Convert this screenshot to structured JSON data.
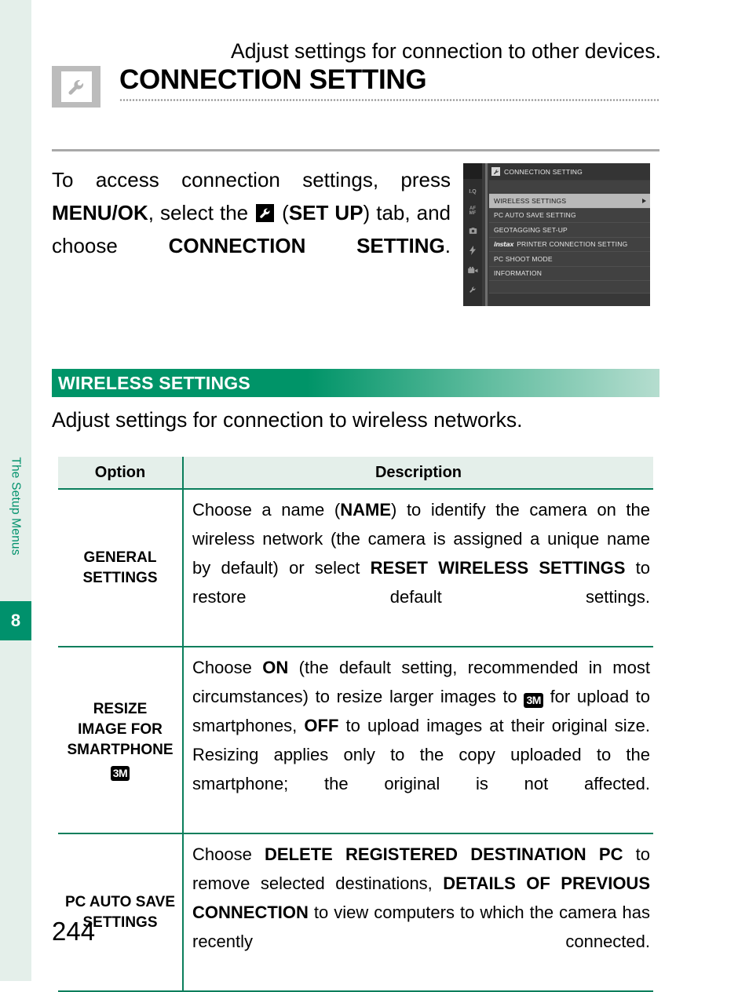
{
  "sidebar": {
    "chapter_label": "The Setup Menus",
    "chapter_number": "8",
    "accent_color": "#00916c",
    "strip_color": "#e4efea"
  },
  "header": {
    "icon": "wrench-icon",
    "title": "CONNECTION SETTING",
    "subtitle": "Adjust settings for connection to other devices."
  },
  "intro": {
    "part1": "To access connection settings, press ",
    "bold1": "MENU/OK",
    "part2": ", select the ",
    "icon": "wrench-icon",
    "part3": " (",
    "bold2": "SET UP",
    "part4": ") tab, and choose ",
    "bold3": "CONNECTION SETTING",
    "part5": "."
  },
  "lcd": {
    "header_icon": "wrench-icon",
    "header_title": "CONNECTION SETTING",
    "tabs": [
      "I.Q",
      "AF/MF",
      "camera-icon",
      "flash-icon",
      "movie-icon",
      "wrench-icon"
    ],
    "tab_labels": {
      "iq": "I.Q",
      "afmf_top": "AF",
      "afmf_bottom": "MF"
    },
    "items": [
      {
        "label": "WIRELESS SETTINGS",
        "selected": true,
        "has_arrow": true
      },
      {
        "label": "PC AUTO SAVE SETTING",
        "selected": false,
        "has_arrow": false
      },
      {
        "label": "GEOTAGGING SET-UP",
        "selected": false,
        "has_arrow": false
      },
      {
        "label": "PRINTER CONNECTION SETTING",
        "prefix": "instax",
        "selected": false,
        "has_arrow": false
      },
      {
        "label": "PC SHOOT MODE",
        "selected": false,
        "has_arrow": false
      },
      {
        "label": "INFORMATION",
        "selected": false,
        "has_arrow": false
      }
    ]
  },
  "section": {
    "title": "WIRELESS SETTINGS",
    "description": "Adjust settings for connection to wireless networks.",
    "accent_color": "#009468"
  },
  "table": {
    "headers": {
      "option": "Option",
      "description": "Description"
    },
    "rows": [
      {
        "option": "GENERAL SETTINGS",
        "option_line1": "GENERAL",
        "option_line2": "SETTINGS",
        "desc": {
          "p1": "Choose a name (",
          "b1": "NAME",
          "p2": ") to identify the camera on the wireless network (the camera is assigned a unique name by default) or select ",
          "b2": "RESET WIRELESS SETTINGS",
          "p3": " to restore default settings."
        }
      },
      {
        "option": "RESIZE IMAGE FOR SMARTPHONE 3M",
        "option_line1": "RESIZE",
        "option_line2": "IMAGE FOR",
        "option_line3": "SMARTPHONE",
        "option_badge": "3M",
        "desc": {
          "p1": "Choose ",
          "b1": "ON",
          "p2": " (the default setting, recommended in most circumstances) to resize larger images to ",
          "badge": "3M",
          "p3": " for upload to smartphones, ",
          "b2": "OFF",
          "p4": " to upload images at their original size. Resizing applies only to the copy uploaded to the smartphone; the original is not affected."
        }
      },
      {
        "option": "PC AUTO SAVE SETTINGS",
        "option_line1": "PC AUTO SAVE",
        "option_line2": "SETTINGS",
        "desc": {
          "p1": "Choose ",
          "b1": "DELETE REGISTERED DESTINATION PC",
          "p2": " to remove selected destinations, ",
          "b2": "DETAILS OF PREVIOUS CONNECTION",
          "p3": " to view computers to which the camera has recently connected."
        }
      }
    ]
  },
  "footer": {
    "page_number": "244"
  }
}
